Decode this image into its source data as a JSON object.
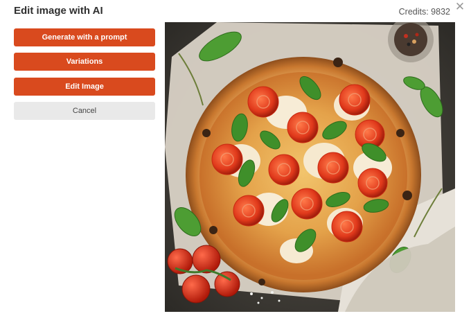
{
  "dialog": {
    "title": "Edit image with AI",
    "credits_label": "Credits: 9832",
    "close_glyph": "✕"
  },
  "actions": {
    "generate_label": "Generate with a prompt",
    "variations_label": "Variations",
    "edit_label": "Edit Image",
    "cancel_label": "Cancel"
  },
  "colors": {
    "primary_button": "#d94a1e",
    "secondary_button": "#e9e9e9"
  }
}
